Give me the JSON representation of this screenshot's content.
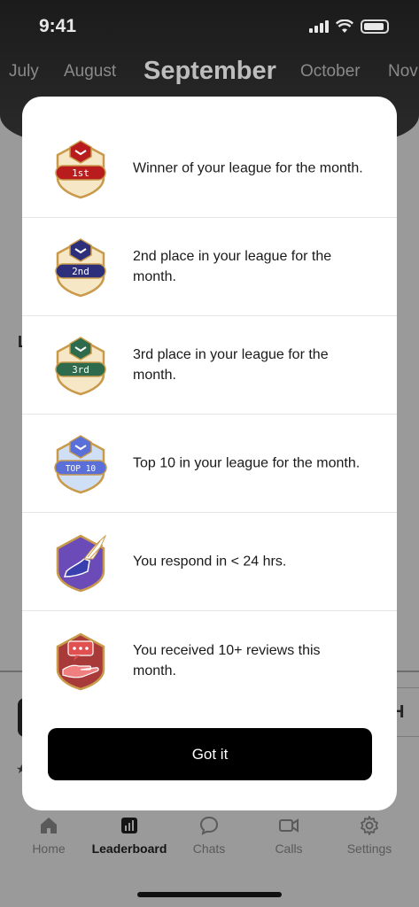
{
  "status_bar": {
    "time": "9:41"
  },
  "month_picker": {
    "months": [
      "July",
      "August",
      "September",
      "October",
      "Nov"
    ],
    "selected": "September"
  },
  "background": {
    "letter": "L",
    "card_label": "H"
  },
  "badges_modal": {
    "items": [
      {
        "icon": "gold-1st-badge-icon",
        "badge_label": "1st",
        "text": "Winner of your league for the month."
      },
      {
        "icon": "2nd-place-badge-icon",
        "badge_label": "2nd",
        "text": "2nd place in your league for the month."
      },
      {
        "icon": "3rd-place-badge-icon",
        "badge_label": "3rd",
        "text": "3rd place in your league for the month."
      },
      {
        "icon": "top-10-badge-icon",
        "badge_label": "TOP 10",
        "text": "Top 10 in your league for the month."
      },
      {
        "icon": "winged-shoe-badge-icon",
        "text": "You respond in < 24 hrs."
      },
      {
        "icon": "reviews-badge-icon",
        "text": "You received 10+ reviews this month."
      }
    ],
    "button_label": "Got it"
  },
  "tabbar": {
    "tabs": [
      {
        "label": "Home",
        "icon": "home-icon"
      },
      {
        "label": "Leaderboard",
        "icon": "leaderboard-icon",
        "active": true
      },
      {
        "label": "Chats",
        "icon": "chat-bubble-icon"
      },
      {
        "label": "Calls",
        "icon": "video-camera-icon"
      },
      {
        "label": "Settings",
        "icon": "gear-icon"
      }
    ]
  },
  "colors": {
    "badge_1st": "#b81c1c",
    "badge_2nd": "#2d2f7a",
    "badge_3rd": "#2e6a4c",
    "badge_top10": "#5a6fd8",
    "badge_response": "#6b4bb8",
    "badge_reviews": "#a83a3a",
    "button": "#000000"
  }
}
